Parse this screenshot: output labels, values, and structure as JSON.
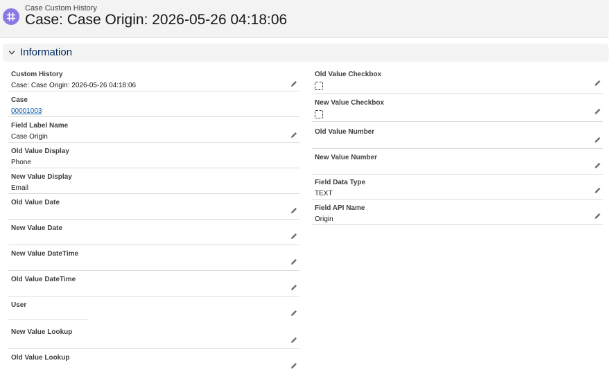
{
  "header": {
    "object_label": "Case Custom History",
    "record_title": "Case: Case Origin: 2026-05-26 04:18:06",
    "icon": "custom-history-icon",
    "icon_color": "#8a79e4"
  },
  "section": {
    "title": "Information",
    "toggle_icon": "chevron-down-icon"
  },
  "left_fields": [
    {
      "label": "Custom History",
      "value": "Case: Case Origin: 2026-05-26 04:18:06"
    },
    {
      "label": "Case",
      "value": "00001003"
    },
    {
      "label": "Field Label Name",
      "value": "Case Origin"
    },
    {
      "label": "Old Value Display",
      "value": "Phone"
    },
    {
      "label": "New Value Display",
      "value": "Email"
    },
    {
      "label": "Old Value Date",
      "value": ""
    },
    {
      "label": "New Value Date",
      "value": ""
    },
    {
      "label": "New Value DateTime",
      "value": ""
    },
    {
      "label": "Old Value DateTime",
      "value": ""
    },
    {
      "label": "User",
      "value": ""
    },
    {
      "label": "New Value Lookup",
      "value": ""
    },
    {
      "label": "Old Value Lookup",
      "value": ""
    }
  ],
  "right_fields": [
    {
      "label": "Old Value Checkbox",
      "value": ""
    },
    {
      "label": "New Value Checkbox",
      "value": ""
    },
    {
      "label": "Old Value Number",
      "value": ""
    },
    {
      "label": "New Value Number",
      "value": ""
    },
    {
      "label": "Field Data Type",
      "value": "TEXT"
    },
    {
      "label": "Field API Name",
      "value": "Origin"
    }
  ],
  "colors": {
    "accent": "#032d60",
    "link": "#0b5cab",
    "header_bg": "#f3f3f3"
  }
}
